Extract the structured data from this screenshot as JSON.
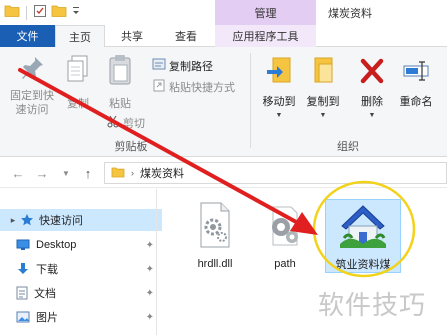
{
  "title_bar": {
    "context_tab": "管理",
    "window_title": "煤炭资料"
  },
  "tabs": [
    "文件",
    "主页",
    "共享",
    "查看",
    "应用程序工具"
  ],
  "ribbon": {
    "pin_quick_access": "固定到快\n速访问",
    "copy": "复制",
    "paste": "粘贴",
    "copy_path": "复制路径",
    "paste_shortcut": "粘贴快捷方式",
    "cut": "剪切",
    "clipboard_label": "剪贴板",
    "move_to": "移动到",
    "copy_to": "复制到",
    "delete": "删除",
    "rename": "重命名",
    "organize_label": "组织"
  },
  "address": {
    "path": "煤炭资料"
  },
  "nav_pane": {
    "quick_access": "快速访问",
    "items": [
      "Desktop",
      "下载",
      "文档",
      "图片"
    ]
  },
  "files": [
    {
      "name": "hrdll.dll",
      "type": "dll"
    },
    {
      "name": "path",
      "type": "settings"
    },
    {
      "name": "筑业资料煤",
      "type": "app",
      "selected": true
    }
  ],
  "watermark": "软件技巧",
  "colors": {
    "file_tab": "#1a5fb4",
    "context_tab": "#e4cdf2",
    "selection": "#cce8ff",
    "arrow": "#e02020",
    "highlight_circle": "#f2d21b"
  }
}
